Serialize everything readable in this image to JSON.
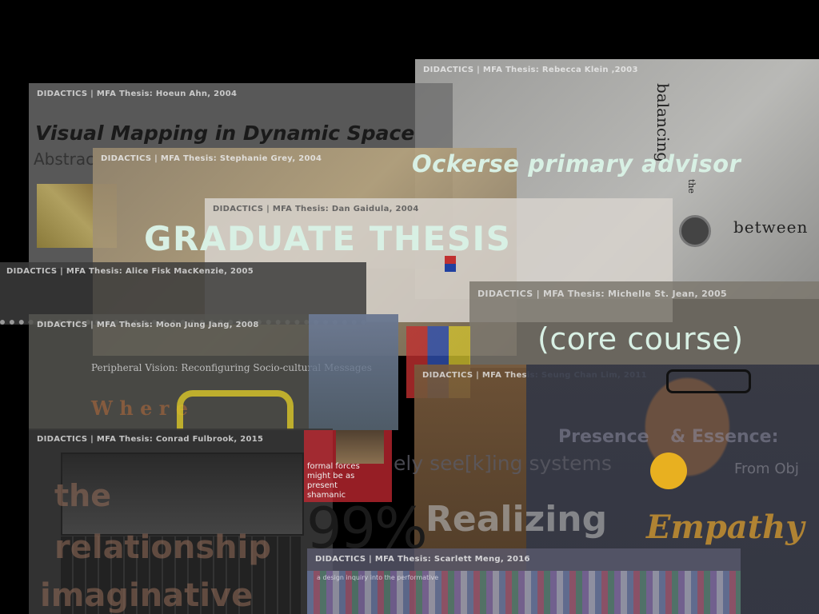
{
  "slide": {
    "advisor_note": "Ockerse primary advisor",
    "heading": "GRADUATE THESIS",
    "subheading": "(core course)"
  },
  "panels": [
    {
      "label": "DIDACTICS | MFA Thesis: Rebecca Klein ,2003"
    },
    {
      "label": "DIDACTICS | MFA Thesis: Hoeun Ahn, 2004"
    },
    {
      "label": "DIDACTICS | MFA Thesis: Stephanie Grey, 2004"
    },
    {
      "label": "DIDACTICS | MFA Thesis: Dan Gaidula, 2004"
    },
    {
      "label": "DIDACTICS | MFA Thesis: Alice Fisk MacKenzie, 2005"
    },
    {
      "label": "DIDACTICS | MFA Thesis: Michelle St. Jean, 2005"
    },
    {
      "label": "DIDACTICS | MFA Thesis: Moon Jung Jang, 2008"
    },
    {
      "label": "DIDACTICS | MFA Thesis: Seung Chan Lim, 2011"
    },
    {
      "label": "DIDACTICS | MFA Thesis: Conrad Fulbrook, 2015"
    },
    {
      "label": "DIDACTICS | MFA Thesis: Scarlett Meng, 2016"
    }
  ],
  "thesis_text": {
    "klein_1": "balancing",
    "klein_2": "the",
    "klein_3": "between",
    "ahn_title": "Visual Mapping in Dynamic Space",
    "ahn_sub": "Abstrac",
    "jang_title": "Peripheral Vision: Reconfiguring Socio-cultural Messages",
    "jang_where": "W h e r e",
    "lim_1": "Presence",
    "lim_2": "& Essence:",
    "lim_3": "From Obj",
    "systems": "ely see[k]ing systems",
    "percent": "99%",
    "realizing": "Realizing",
    "empathy": "Empathy",
    "rel_1": "the",
    "rel_2": "relationship",
    "rel_3": "imaginative",
    "forces_1": "formal forces",
    "forces_2": "might be as",
    "forces_3": "present",
    "forces_4": "shamanic",
    "meng_sub": "a design inquiry into the performative"
  },
  "colors": {
    "overlay_text": "#d8f0e4",
    "background": "#000000"
  }
}
